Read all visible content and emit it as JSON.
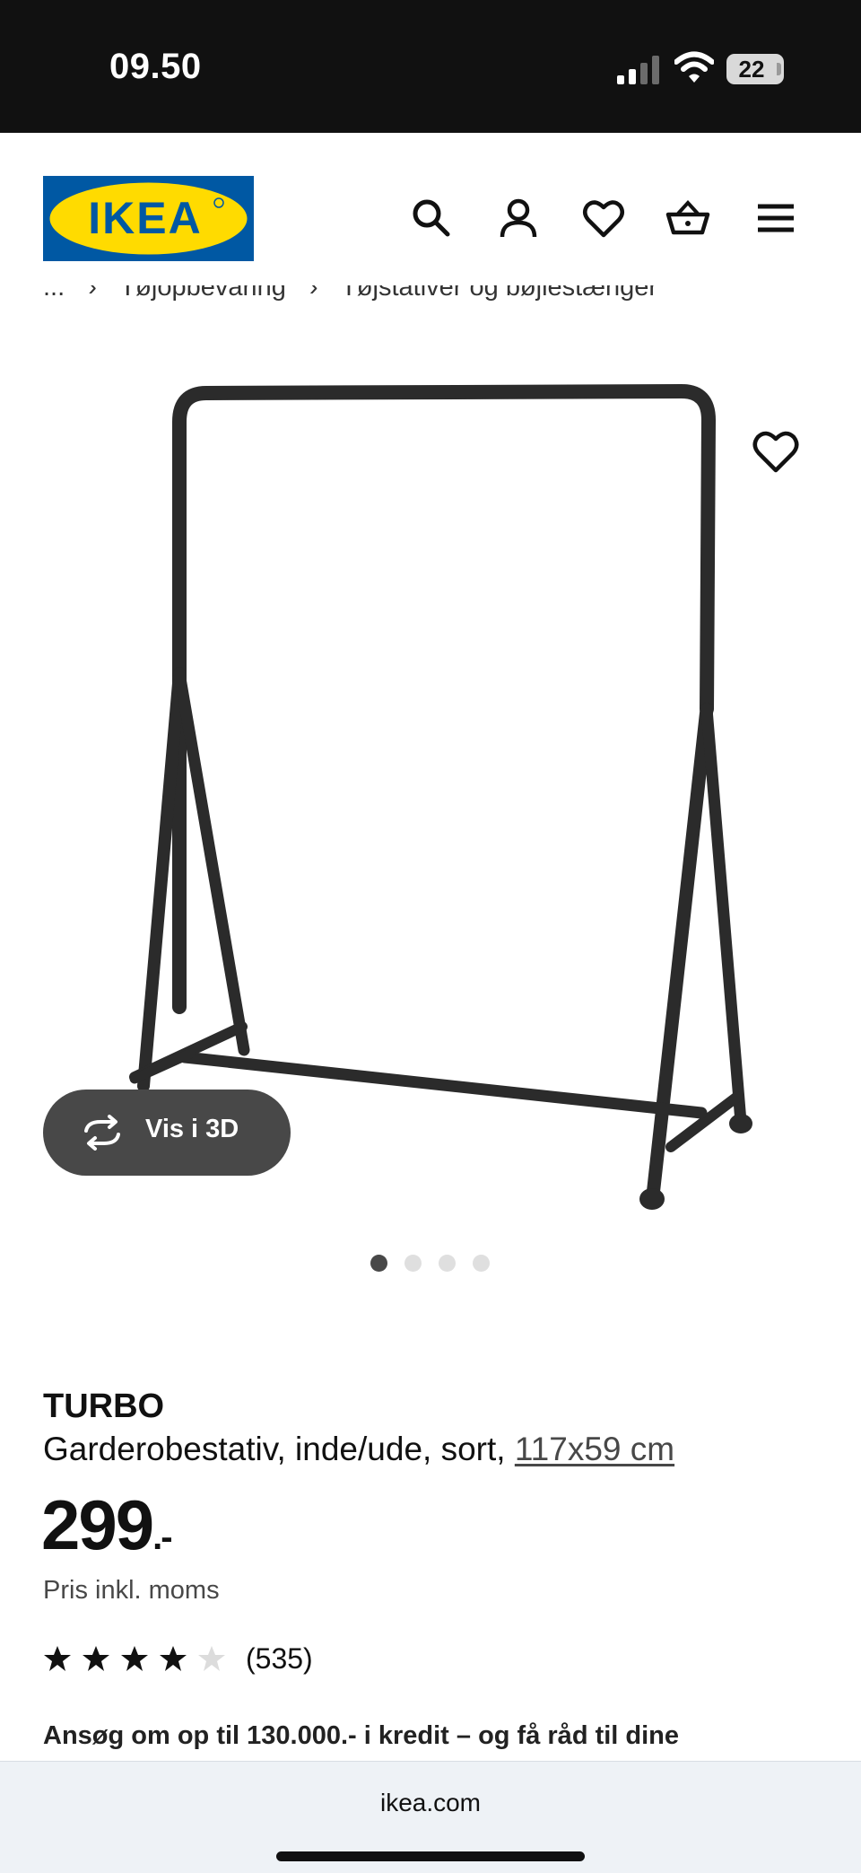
{
  "status_bar": {
    "time": "09.50",
    "battery": "22",
    "icons": [
      "cellular-signal-icon",
      "wifi-icon",
      "battery-icon"
    ]
  },
  "header": {
    "logo_text": "IKEA",
    "logo_colors": {
      "blue": "#0058A3",
      "yellow": "#FFDB00"
    },
    "icons": [
      "search-icon",
      "account-icon",
      "heart-icon",
      "basket-icon",
      "menu-icon"
    ]
  },
  "breadcrumb": {
    "items": [
      "...",
      "›",
      "Tøjopbevaring",
      "›",
      "Tøjstativer og bøjlestænger"
    ]
  },
  "media": {
    "view3d_label": "Vis i 3D",
    "image_count": 4,
    "active_image": 1
  },
  "product": {
    "name": "TURBO",
    "description": "Garderobestativ, inde/ude, sort,",
    "size": "117x59 cm",
    "price_main": "299",
    "price_suffix": ".-",
    "price_note": "Pris inkl. moms",
    "rating_value": 4,
    "rating_max": 5,
    "review_count": "(535)",
    "credit_promo": "Ansøg om op til 130.000.- i kredit – og få råd til dine"
  },
  "browser": {
    "url": "ikea.com"
  }
}
